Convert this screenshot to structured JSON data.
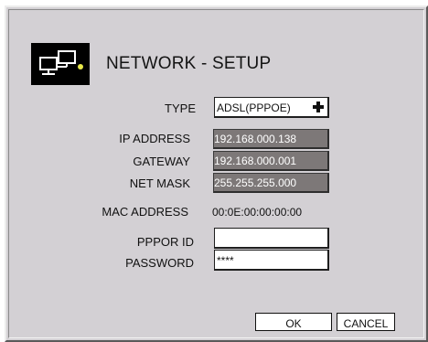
{
  "dialog": {
    "title": "NETWORK - SETUP",
    "icon": "network-computers-icon"
  },
  "form": {
    "type_label": "TYPE",
    "type_value": "ADSL(PPPOE)",
    "ip_label": "IP ADDRESS",
    "ip_value": "192.168.000.138",
    "gateway_label": "GATEWAY",
    "gateway_value": "192.168.000.001",
    "netmask_label": "NET MASK",
    "netmask_value": "255.255.255.000",
    "mac_label": "MAC ADDRESS",
    "mac_value": "00:0E:00:00:00:00",
    "pppoe_id_label": "PPPOR ID",
    "pppoe_id_value": "",
    "password_label": "PASSWORD",
    "password_value": "****"
  },
  "buttons": {
    "ok_label": "OK",
    "cancel_label": "CANCEL"
  },
  "colors": {
    "panel": "#d3d0d4",
    "disabled_field": "#7d7878",
    "icon_accent": "#e8e84a"
  }
}
